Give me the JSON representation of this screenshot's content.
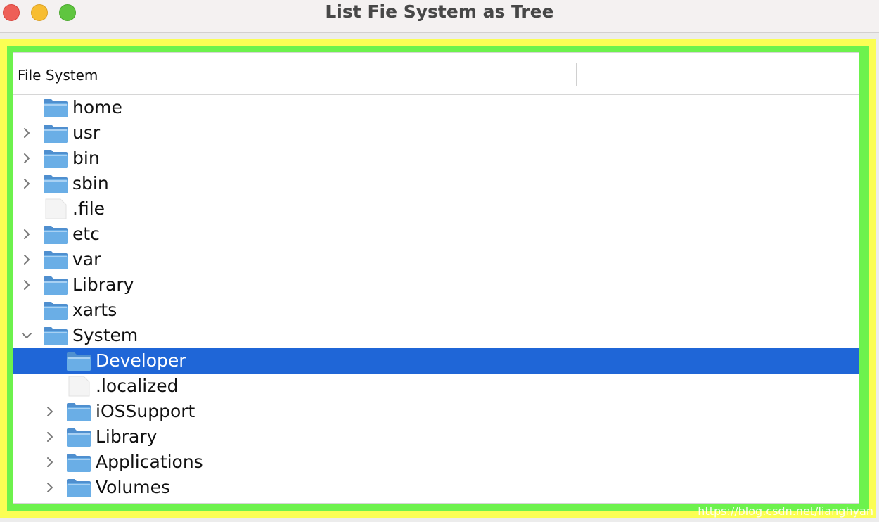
{
  "window": {
    "title": "List Fie System as Tree"
  },
  "tree": {
    "column_header": "File System",
    "rows": [
      {
        "label": "home",
        "depth": 0,
        "kind": "folder",
        "expander": "none",
        "selected": false
      },
      {
        "label": "usr",
        "depth": 0,
        "kind": "folder",
        "expander": "collapsed",
        "selected": false
      },
      {
        "label": "bin",
        "depth": 0,
        "kind": "folder",
        "expander": "collapsed",
        "selected": false
      },
      {
        "label": "sbin",
        "depth": 0,
        "kind": "folder",
        "expander": "collapsed",
        "selected": false
      },
      {
        "label": ".file",
        "depth": 0,
        "kind": "file",
        "expander": "none",
        "selected": false
      },
      {
        "label": "etc",
        "depth": 0,
        "kind": "folder",
        "expander": "collapsed",
        "selected": false
      },
      {
        "label": "var",
        "depth": 0,
        "kind": "folder",
        "expander": "collapsed",
        "selected": false
      },
      {
        "label": "Library",
        "depth": 0,
        "kind": "folder",
        "expander": "collapsed",
        "selected": false
      },
      {
        "label": "xarts",
        "depth": 0,
        "kind": "folder",
        "expander": "none",
        "selected": false
      },
      {
        "label": "System",
        "depth": 0,
        "kind": "folder",
        "expander": "expanded",
        "selected": false
      },
      {
        "label": "Developer",
        "depth": 1,
        "kind": "folder",
        "expander": "none",
        "selected": true
      },
      {
        "label": ".localized",
        "depth": 1,
        "kind": "file",
        "expander": "none",
        "selected": false
      },
      {
        "label": "iOSSupport",
        "depth": 1,
        "kind": "folder",
        "expander": "collapsed",
        "selected": false
      },
      {
        "label": "Library",
        "depth": 1,
        "kind": "folder",
        "expander": "collapsed",
        "selected": false
      },
      {
        "label": "Applications",
        "depth": 1,
        "kind": "folder",
        "expander": "collapsed",
        "selected": false
      },
      {
        "label": "Volumes",
        "depth": 1,
        "kind": "folder",
        "expander": "collapsed",
        "selected": false
      }
    ]
  },
  "watermark": "https://blog.csdn.net/lianghyan",
  "colors": {
    "selection": "#1f66d7",
    "frame_outer": "#fbfe54",
    "frame_inner": "#6df24d",
    "folder": "#6aaee6"
  },
  "icons": {
    "folder": "folder-icon",
    "file": "file-icon",
    "collapsed": "chevron-right-icon",
    "expanded": "chevron-down-icon"
  }
}
